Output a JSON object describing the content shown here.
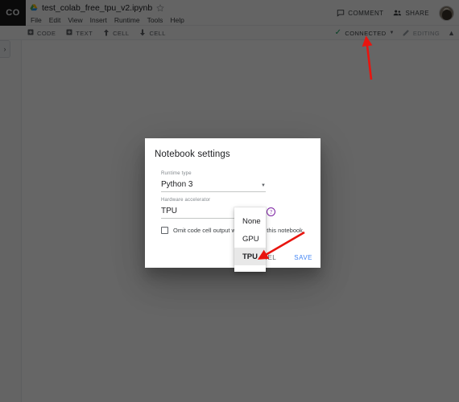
{
  "app": {
    "logo_text": "CO",
    "doc_title": "test_colab_free_tpu_v2.ipynb",
    "menu_items": [
      "File",
      "Edit",
      "View",
      "Insert",
      "Runtime",
      "Tools",
      "Help"
    ],
    "top_actions": {
      "comment_label": "COMMENT",
      "share_label": "SHARE"
    },
    "toolbar": {
      "add_code_label": "CODE",
      "add_text_label": "TEXT",
      "move_up_label": "CELL",
      "move_down_label": "CELL",
      "connected_label": "CONNECTED",
      "editing_label": "EDITING"
    }
  },
  "dialog": {
    "title": "Notebook settings",
    "runtime_type": {
      "label": "Runtime type",
      "value": "Python 3"
    },
    "hardware_accelerator": {
      "label": "Hardware accelerator",
      "value": "TPU",
      "help_glyph": "?",
      "options": [
        "None",
        "GPU",
        "TPU"
      ],
      "selected_option": "TPU"
    },
    "omit_output": {
      "label": "Omit code cell output when saving this notebook",
      "checked": false
    },
    "cancel_label": "CANCEL",
    "save_label": "SAVE"
  },
  "colors": {
    "accent_blue": "#4285f4",
    "connected_green": "#0f9d58",
    "help_purple": "#7b1fa2",
    "annotation_red": "#e8150f",
    "scrim": "rgba(0,0,0,0.60)"
  }
}
